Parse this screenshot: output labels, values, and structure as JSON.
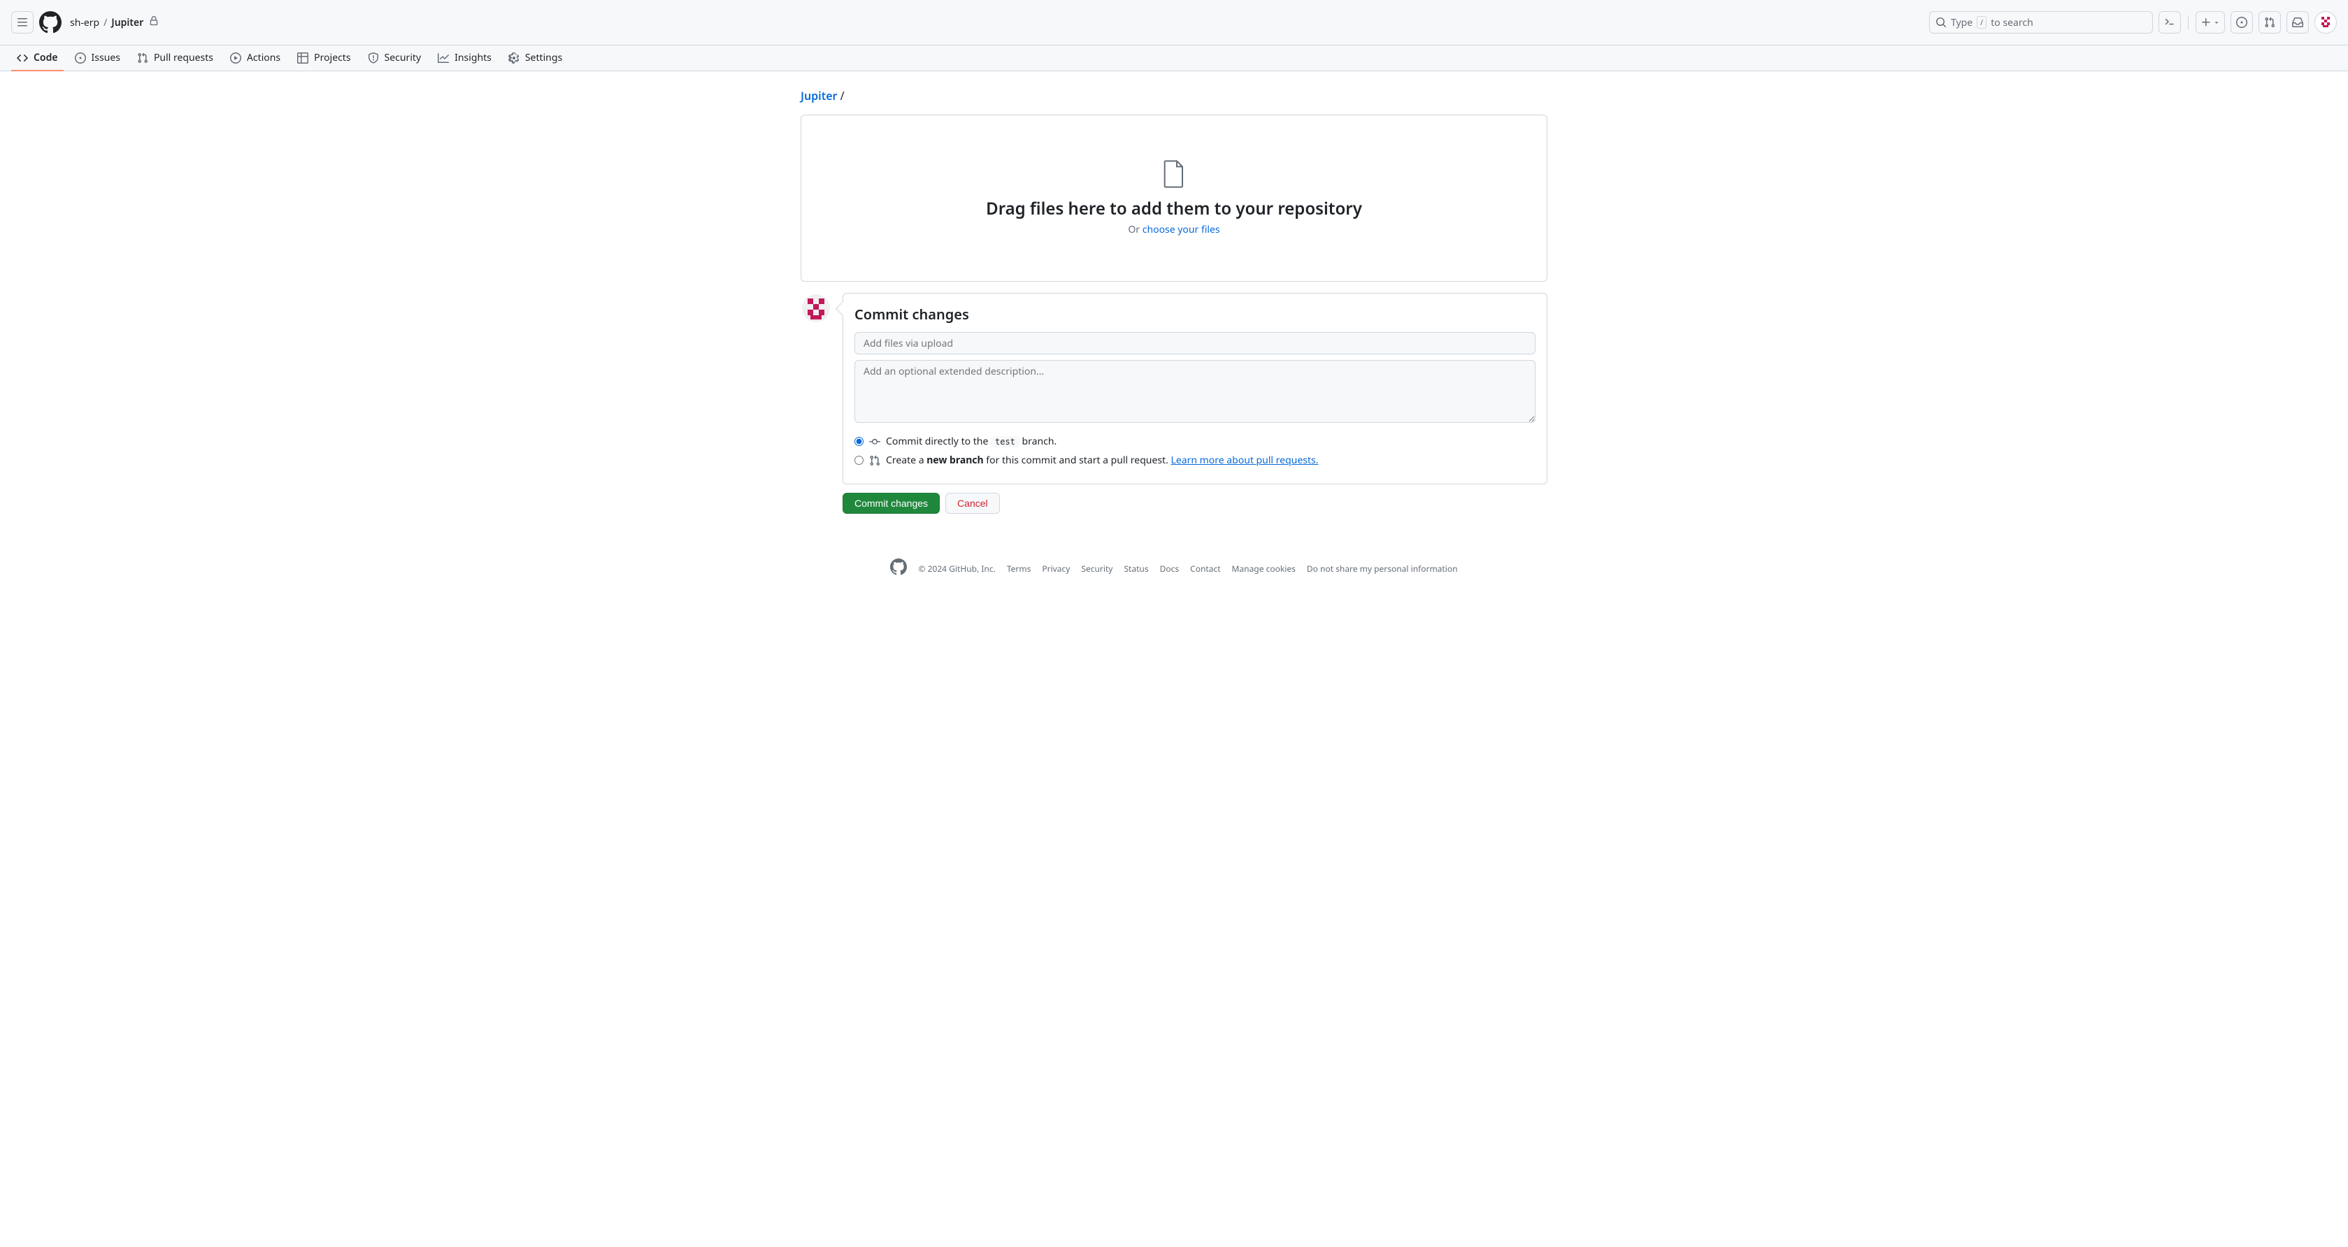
{
  "header": {
    "owner": "sh-erp",
    "repo": "Jupiter",
    "sep": "/",
    "search_prefix": "Type",
    "search_kbd": "/",
    "search_suffix": "to search"
  },
  "nav": {
    "items": [
      {
        "label": "Code"
      },
      {
        "label": "Issues"
      },
      {
        "label": "Pull requests"
      },
      {
        "label": "Actions"
      },
      {
        "label": "Projects"
      },
      {
        "label": "Security"
      },
      {
        "label": "Insights"
      },
      {
        "label": "Settings"
      }
    ]
  },
  "main": {
    "breadcrumb_repo": "Jupiter",
    "breadcrumb_sep": "/",
    "drop_title": "Drag files here to add them to your repository",
    "drop_or": "Or ",
    "drop_link": "choose your files"
  },
  "commit": {
    "title": "Commit changes",
    "summary_placeholder": "Add files via upload",
    "desc_placeholder": "Add an optional extended description…",
    "opt1_prefix": "Commit directly to the ",
    "opt1_branch": "test",
    "opt1_suffix": " branch.",
    "opt2_prefix": "Create a ",
    "opt2_bold": "new branch",
    "opt2_suffix": " for this commit and start a pull request. ",
    "opt2_link": "Learn more about pull requests.",
    "commit_btn": "Commit changes",
    "cancel_btn": "Cancel"
  },
  "footer": {
    "copyright": "© 2024 GitHub, Inc.",
    "links": [
      "Terms",
      "Privacy",
      "Security",
      "Status",
      "Docs",
      "Contact",
      "Manage cookies",
      "Do not share my personal information"
    ]
  }
}
